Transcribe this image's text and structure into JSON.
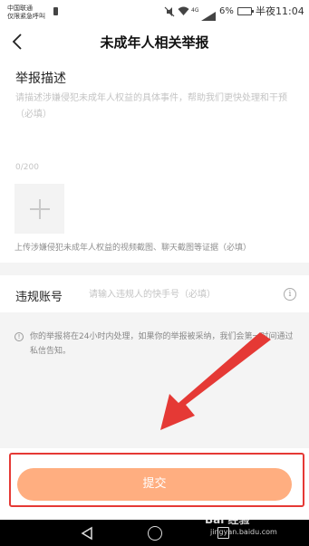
{
  "status_bar": {
    "carrier_name": "中国联通",
    "carrier_sub": "仅限紧急呼叫",
    "network_label": "4G",
    "battery_percent": "6%",
    "time": "半夜11:04"
  },
  "header": {
    "back_icon": "chevron-left-icon",
    "title": "未成年人相关举报"
  },
  "description": {
    "title": "举报描述",
    "placeholder": "请描述涉嫌侵犯未成年人权益的具体事件，帮助我们更快处理和干预（必填）",
    "value": "",
    "char_count": "0/200",
    "add_photo_icon": "plus-icon",
    "upload_hint": "上传涉嫌侵犯未成年人权益的视频截图、聊天截图等证据（必填）"
  },
  "account": {
    "label": "违规账号",
    "placeholder": "请输入违规人的快手号（必填）",
    "value": "",
    "info_icon": "info-icon",
    "info_glyph": "i"
  },
  "notice": {
    "icon": "info-icon",
    "icon_glyph": "!",
    "text": "你的举报将在24小时内处理，如果你的举报被采纳，我们会第一时间通过私信告知。"
  },
  "submit": {
    "label": "提交",
    "color": "#ffae80"
  },
  "nav_bar": {
    "back_icon": "triangle-back-icon",
    "home_icon": "circle-home-icon",
    "recent_icon": "square-recent-icon"
  },
  "watermark": {
    "text": "Bai 经验",
    "url": "jingyan.baidu.com"
  },
  "colors": {
    "accent": "#ffae80",
    "highlight": "#e53935",
    "background_gray": "#f4f4f4"
  }
}
